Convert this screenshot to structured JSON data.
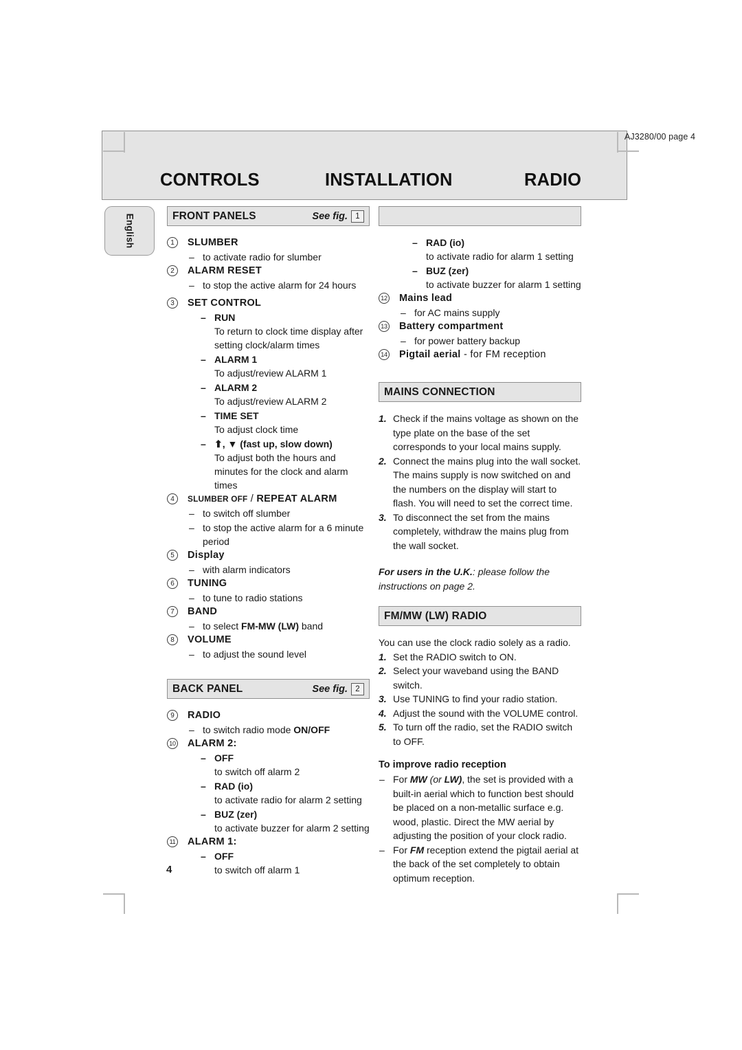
{
  "document": {
    "doc_code": "AJ3280/00 page 4",
    "page_number": "4",
    "language_tab": "English"
  },
  "header": {
    "titles": {
      "controls": "CONTROLS",
      "installation": "INSTALLATION",
      "radio": "RADIO"
    }
  },
  "left_column": {
    "front_panels": {
      "title": "FRONT PANELS",
      "see_fig_label": "See fig.",
      "see_fig_number": "1",
      "items": [
        {
          "number": "1",
          "title": "SLUMBER",
          "lines": [
            {
              "kind": "dash",
              "text": "to activate radio for slumber"
            }
          ]
        },
        {
          "number": "2",
          "title": "ALARM RESET",
          "lines": [
            {
              "kind": "dash",
              "text": "to stop the active alarm for 24 hours"
            }
          ]
        },
        {
          "number": "3",
          "title": "SET CONTROL",
          "subitems": [
            {
              "label": "RUN",
              "body": "To return to clock time display after setting clock/alarm times"
            },
            {
              "label": "ALARM 1",
              "body": "To adjust/review ALARM 1"
            },
            {
              "label": "ALARM 2",
              "body": "To adjust/review ALARM 2"
            },
            {
              "label": "TIME SET",
              "body": "To adjust clock time"
            },
            {
              "label_arrows": "⬆, ▼ (fast up, slow down)",
              "body": "To adjust both the hours and minutes for the clock and alarm times"
            }
          ]
        },
        {
          "number": "4",
          "title_small": "SLUMBER OFF",
          "title_sep": " / ",
          "title_main": "REPEAT ALARM",
          "lines": [
            {
              "kind": "dash",
              "text": "to switch off slumber"
            },
            {
              "kind": "dash",
              "text": "to stop the active alarm for a 6 minute period"
            }
          ]
        },
        {
          "number": "5",
          "title": "Display",
          "lines": [
            {
              "kind": "dash",
              "text": "with alarm indicators"
            }
          ]
        },
        {
          "number": "6",
          "title": "TUNING",
          "lines": [
            {
              "kind": "dash",
              "text": "to tune to radio stations"
            }
          ]
        },
        {
          "number": "7",
          "title": "BAND",
          "lines": [
            {
              "kind": "dash",
              "text": "to select FM-MW (LW) band"
            }
          ]
        },
        {
          "number": "8",
          "title": "VOLUME",
          "lines": [
            {
              "kind": "dash",
              "text": "to adjust the sound level"
            }
          ]
        }
      ]
    },
    "back_panel": {
      "title": "BACK PANEL",
      "see_fig_label": "See fig.",
      "see_fig_number": "2",
      "items": [
        {
          "number": "9",
          "title": "RADIO",
          "dash_text_pre": "to switch radio mode ",
          "dash_text_bold": "ON/OFF"
        },
        {
          "number": "10",
          "title": "ALARM 2:",
          "subitems": [
            {
              "label": "OFF",
              "body": "to switch off alarm 2"
            },
            {
              "label": "RAD (io)",
              "body": "to activate radio for alarm 2 setting"
            },
            {
              "label": "BUZ (zer)",
              "body": "to activate buzzer for alarm 2 setting"
            }
          ]
        },
        {
          "number": "11",
          "title": "ALARM 1:",
          "subitems": [
            {
              "label": "OFF",
              "body": "to switch off alarm 1"
            }
          ]
        }
      ]
    }
  },
  "right_column": {
    "continuation": {
      "subitems": [
        {
          "label": "RAD (io)",
          "body": "to activate radio for alarm 1 setting"
        },
        {
          "label": "BUZ (zer)",
          "body": "to activate buzzer for alarm 1 setting"
        }
      ],
      "items": [
        {
          "number": "12",
          "title": "Mains lead",
          "dash_text": "for AC mains supply"
        },
        {
          "number": "13",
          "title": "Battery compartment",
          "dash_text": "for power battery backup"
        },
        {
          "number": "14",
          "title": "Pigtail aerial",
          "title_suffix": " - for FM reception"
        }
      ]
    },
    "mains_connection": {
      "title": "MAINS CONNECTION",
      "steps": [
        {
          "n": "1.",
          "text": "Check if the mains voltage as shown on the type plate on the base of the set corresponds to your local mains supply."
        },
        {
          "n": "2.",
          "text": "Connect the mains plug into the wall socket. The mains supply is now switched on and the numbers on the display will start to flash. You will need to set the correct time."
        },
        {
          "n": "3.",
          "text": "To disconnect the set from the mains completely, withdraw the mains plug from the wall socket."
        }
      ],
      "uk_note_bold": "For users in the U.K.",
      "uk_note_rest": ": please follow the instructions on page 2."
    },
    "fm_mw_radio": {
      "title": "FM/MW (LW) RADIO",
      "intro": "You can use the clock radio solely as a radio.",
      "steps": [
        {
          "n": "1.",
          "text": "Set the RADIO switch to ON."
        },
        {
          "n": "2.",
          "text": "Select your waveband using the BAND switch."
        },
        {
          "n": "3.",
          "text": "Use TUNING to find your radio station."
        },
        {
          "n": "4.",
          "text": "Adjust the sound with the VOLUME control."
        },
        {
          "n": "5.",
          "text": "To turn off the radio, set the RADIO switch to OFF."
        }
      ],
      "improve_heading": "To improve radio reception",
      "improve_bullets": [
        {
          "pre": "For ",
          "em1": "MW",
          "mid": " (or ",
          "em2": "LW)",
          "post": ", the set is provided with a built-in aerial which to function best should be placed on a non-metallic surface e.g. wood, plastic. Direct the MW aerial by adjusting the position of your clock radio."
        },
        {
          "pre": "For ",
          "em1": "FM",
          "mid": "",
          "em2": "",
          "post": " reception extend the pigtail aerial at the back of the set completely to obtain optimum reception."
        }
      ]
    }
  }
}
